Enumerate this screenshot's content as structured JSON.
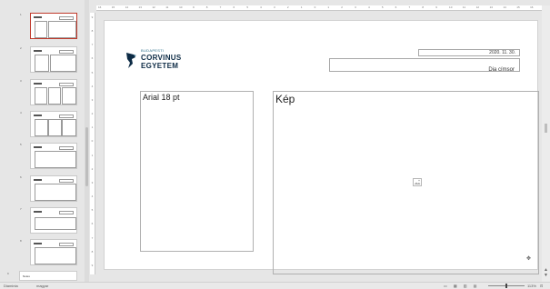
{
  "thumbnails": {
    "numbers": [
      "1",
      "2",
      "3",
      "4",
      "5",
      "6",
      "7",
      "8"
    ],
    "notes_number": "9",
    "notes_label": "Notes"
  },
  "ruler": {
    "h_ticks": [
      "16",
      "15",
      "14",
      "13",
      "12",
      "11",
      "10",
      "9",
      "8",
      "7",
      "6",
      "5",
      "4",
      "3",
      "2",
      "1",
      "0",
      "1",
      "2",
      "3",
      "4",
      "5",
      "6",
      "7",
      "8",
      "9",
      "10",
      "11",
      "12",
      "13",
      "14",
      "15",
      "16"
    ],
    "v_ticks": [
      "9",
      "8",
      "7",
      "6",
      "5",
      "4",
      "3",
      "2",
      "1",
      "0",
      "1",
      "2",
      "3",
      "4",
      "5",
      "6",
      "7",
      "8",
      "9"
    ]
  },
  "slide": {
    "logo_small": "BUDAPESTI",
    "logo_line1": "CORVINUS",
    "logo_line2": "EGYETEM",
    "date": "2020. 11. 30.",
    "title": "Dia címsor",
    "text_placeholder": "Arial 18 pt",
    "image_placeholder": "Kép"
  },
  "statusbar": {
    "mode": "Diaminta",
    "language": "magyar",
    "zoom": "113%"
  },
  "colors": {
    "selected_border": "#c0392b",
    "logo_dark": "#0d2b45",
    "logo_accent": "#2a6e8a"
  }
}
